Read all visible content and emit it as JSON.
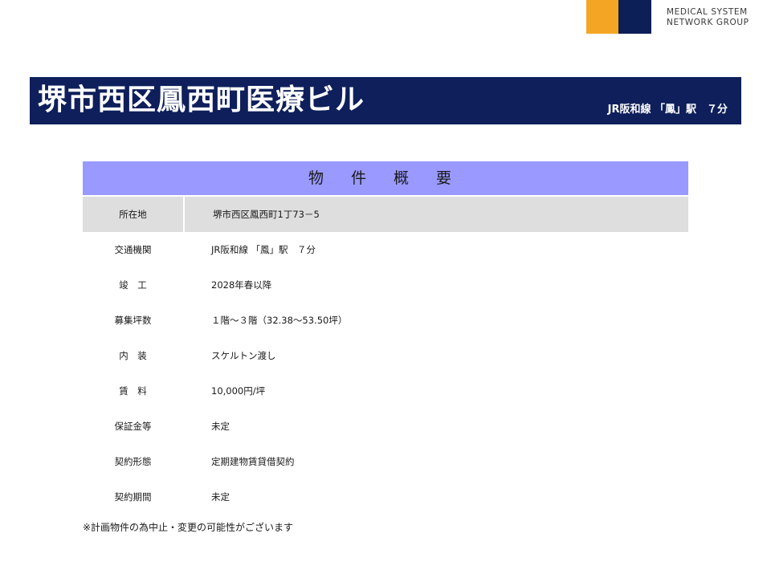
{
  "logo": {
    "line1": "MEDICAL SYSTEM",
    "line2": "NETWORK GROUP",
    "colors": {
      "yellow": "#f5a524",
      "navy": "#0d1f57"
    }
  },
  "title_bar": {
    "title": "堺市西区鳳西町医療ビル",
    "access": "JR阪和線 「鳳」駅　７分",
    "color": "#0e1f5b"
  },
  "table": {
    "header": "物 件 概 要",
    "header_color": "#9999ff",
    "rows": [
      {
        "label": "所在地",
        "value": "堺市西区鳳西町1丁73－5"
      },
      {
        "label": "交通機関",
        "value": "JR阪和線 「鳳」駅　７分"
      },
      {
        "label": "竣　工",
        "value": "2028年春以降"
      },
      {
        "label": "募集坪数",
        "value": "１階～３階（32.38～53.50坪）"
      },
      {
        "label": "内　装",
        "value": "スケルトン渡し"
      },
      {
        "label": "賃　料",
        "value": "10,000円/坪"
      },
      {
        "label": "保証金等",
        "value": "未定"
      },
      {
        "label": "契約形態",
        "value": "定期建物賃貸借契約"
      },
      {
        "label": "契約期間",
        "value": "未定"
      }
    ]
  },
  "note": "※計画物件の為中止・変更の可能性がございます"
}
